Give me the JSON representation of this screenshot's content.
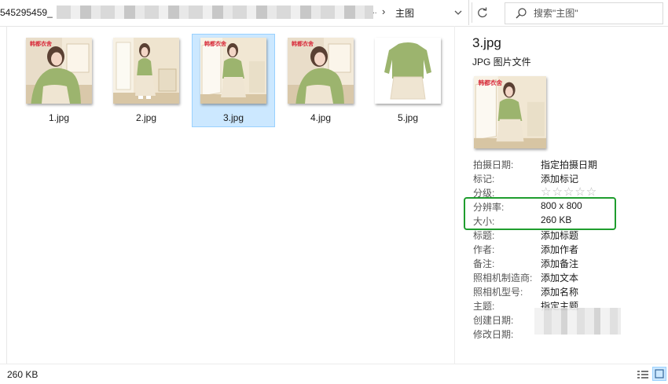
{
  "address_bar": {
    "path_prefix": "545295459_",
    "ellipsis": "..",
    "current_folder": "主图"
  },
  "search": {
    "placeholder": "搜索\"主图\""
  },
  "files": [
    {
      "name": "1.jpg",
      "selected": false,
      "watermark": "韩都衣舍"
    },
    {
      "name": "2.jpg",
      "selected": false,
      "watermark": ""
    },
    {
      "name": "3.jpg",
      "selected": true,
      "watermark": "韩都衣舍"
    },
    {
      "name": "4.jpg",
      "selected": false,
      "watermark": "韩都衣舍"
    },
    {
      "name": "5.jpg",
      "selected": false,
      "watermark": ""
    }
  ],
  "details": {
    "title": "3.jpg",
    "type": "JPG 图片文件",
    "properties": [
      {
        "key": "拍摄日期:",
        "value": "指定拍摄日期"
      },
      {
        "key": "标记:",
        "value": "添加标记"
      },
      {
        "key": "分级:",
        "value": "☆☆☆☆☆"
      },
      {
        "key": "分辨率:",
        "value": "800 x 800"
      },
      {
        "key": "大小:",
        "value": "260 KB"
      },
      {
        "key": "标题:",
        "value": "添加标题"
      },
      {
        "key": "作者:",
        "value": "添加作者"
      },
      {
        "key": "备注:",
        "value": "添加备注"
      },
      {
        "key": "照相机制造商:",
        "value": "添加文本"
      },
      {
        "key": "照相机型号:",
        "value": "添加名称"
      },
      {
        "key": "主题:",
        "value": "指定主题"
      },
      {
        "key": "创建日期:",
        "value": ""
      },
      {
        "key": "修改日期:",
        "value": ""
      }
    ]
  },
  "status_bar": {
    "selection_size": "260 KB"
  },
  "colors": {
    "selection_bg": "#cce8ff",
    "selection_border": "#99d1ff",
    "highlight_box": "#1f9d2e",
    "sweater_green": "#9cb46e",
    "skirt_cream": "#efe5d2",
    "watermark_red": "#d82a3a"
  },
  "icons": [
    "chevron-right-icon",
    "dropdown-chevron-icon",
    "refresh-icon",
    "search-icon",
    "details-view-icon",
    "large-icons-view-icon"
  ]
}
